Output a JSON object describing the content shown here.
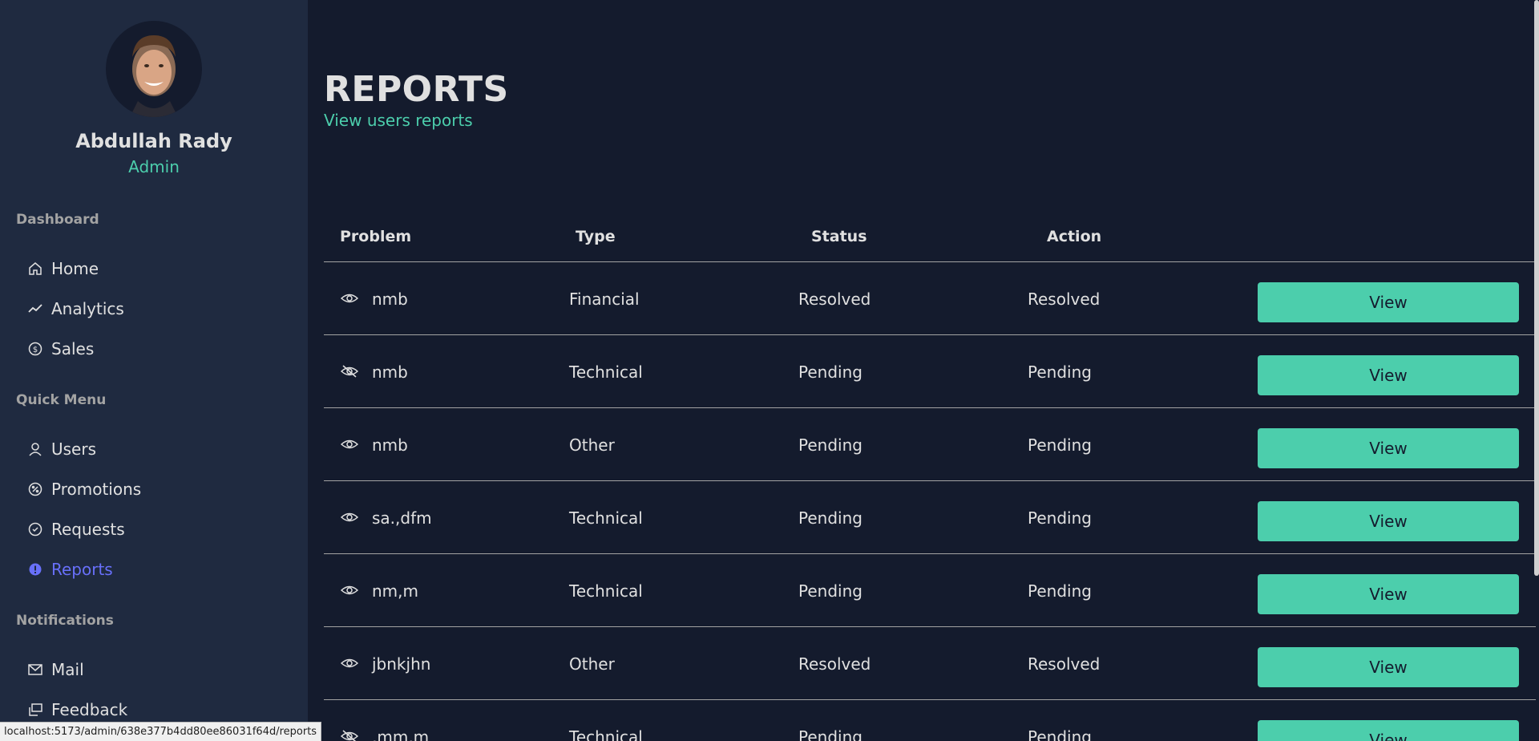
{
  "profile": {
    "name": "Abdullah Rady",
    "role": "Admin"
  },
  "sidebar": {
    "sections": [
      {
        "title": "Dashboard"
      },
      {
        "title": "Quick Menu"
      },
      {
        "title": "Notifications"
      }
    ],
    "items": [
      {
        "label": "Home",
        "icon": "home-icon"
      },
      {
        "label": "Analytics",
        "icon": "trend-line-icon"
      },
      {
        "label": "Sales",
        "icon": "dollar-circle-icon"
      },
      {
        "label": "Users",
        "icon": "person-icon"
      },
      {
        "label": "Promotions",
        "icon": "discount-icon"
      },
      {
        "label": "Requests",
        "icon": "request-icon"
      },
      {
        "label": "Reports",
        "icon": "report-icon",
        "active": true
      },
      {
        "label": "Mail",
        "icon": "mail-icon"
      },
      {
        "label": "Feedback",
        "icon": "feedback-icon"
      }
    ]
  },
  "status_url": "localhost:5173/admin/638e377b4dd80ee86031f64d/reports",
  "header": {
    "title": "REPORTS",
    "subtitle": "View users reports"
  },
  "table": {
    "columns": [
      "Problem",
      "Type",
      "Status",
      "Action"
    ],
    "view_label": "View",
    "rows": [
      {
        "problem": "nmb",
        "type": "Financial",
        "status": "Resolved",
        "action": "Resolved",
        "icon": "eye-icon"
      },
      {
        "problem": "nmb",
        "type": "Technical",
        "status": "Pending",
        "action": "Pending",
        "icon": "eye-off-icon"
      },
      {
        "problem": "nmb",
        "type": "Other",
        "status": "Pending",
        "action": "Pending",
        "icon": "eye-icon"
      },
      {
        "problem": "sa.,dfm",
        "type": "Technical",
        "status": "Pending",
        "action": "Pending",
        "icon": "eye-icon"
      },
      {
        "problem": "nm,m",
        "type": "Technical",
        "status": "Pending",
        "action": "Pending",
        "icon": "eye-icon"
      },
      {
        "problem": "jbnkjhn",
        "type": "Other",
        "status": "Resolved",
        "action": "Resolved",
        "icon": "eye-icon"
      },
      {
        "problem": ",mm,m",
        "type": "Technical",
        "status": "Pending",
        "action": "Pending",
        "icon": "eye-off-icon"
      }
    ]
  },
  "colors": {
    "accent": "#4cceac",
    "active": "#6870fa",
    "background": "#141b2d",
    "sidebar": "#1f2a40"
  }
}
